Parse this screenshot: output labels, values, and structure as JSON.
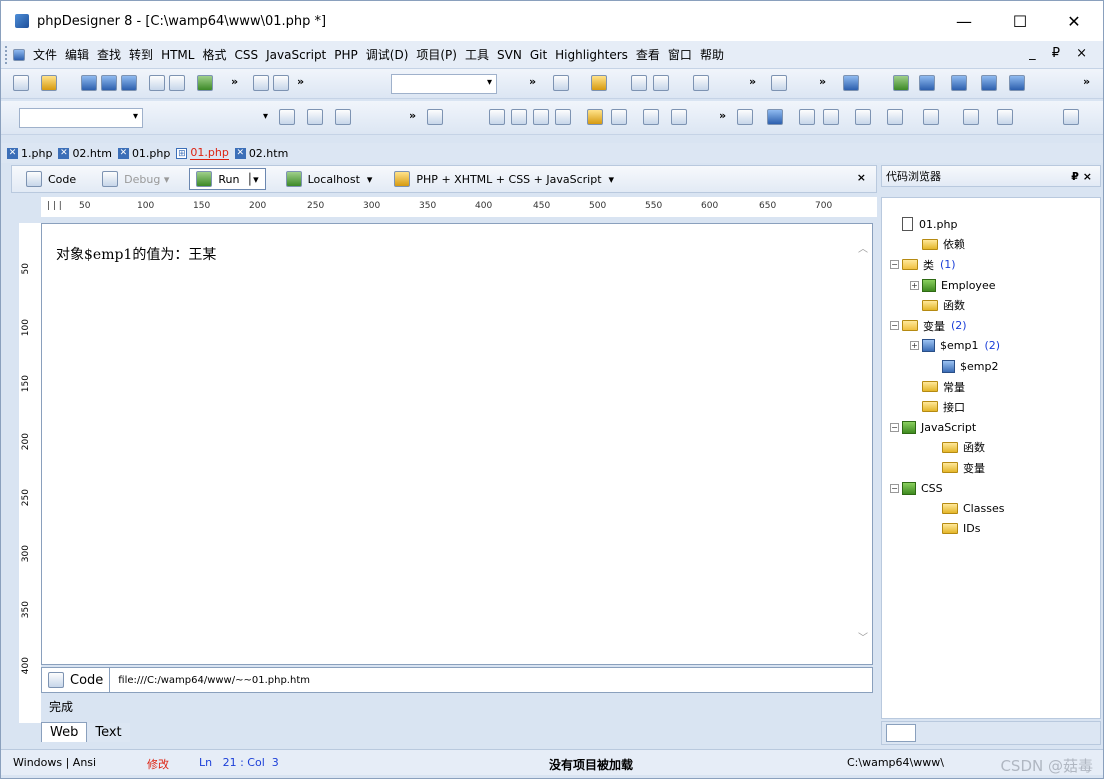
{
  "window": {
    "title": "phpDesigner 8 - [C:\\wamp64\\www\\01.php *]",
    "controls": [
      "—",
      "☐",
      "✕"
    ]
  },
  "menu": {
    "items": [
      "文件",
      "编辑",
      "查找",
      "转到",
      "HTML",
      "格式",
      "CSS",
      "JavaScript",
      "PHP",
      "调试(D)",
      "项目(P)",
      "工具",
      "SVN",
      "Git",
      "Highlighters",
      "查看",
      "窗口",
      "帮助"
    ],
    "right": "_ ₽ ×"
  },
  "tabs": [
    {
      "label": "1.php",
      "active": false
    },
    {
      "label": "02.htm",
      "active": false
    },
    {
      "label": "01.php",
      "active": false
    },
    {
      "label": "01.php",
      "active": true
    },
    {
      "label": "02.htm",
      "active": false
    }
  ],
  "doc_toolbar": {
    "code": "Code",
    "debug": "Debug",
    "run": "Run",
    "localhost": "Localhost",
    "mode": "PHP + XHTML + CSS + JavaScript",
    "close": "×"
  },
  "ruler": [
    "50",
    "100",
    "150",
    "200",
    "250",
    "300",
    "350",
    "400",
    "450",
    "500",
    "550",
    "600",
    "650",
    "700"
  ],
  "vruler": [
    "50",
    "100",
    "150",
    "200",
    "250",
    "300",
    "350",
    "400"
  ],
  "editor": {
    "content": "对象$emp1的值为：王某"
  },
  "address": {
    "code_label": "Code",
    "url": "file:///C:/wamp64/www/~~01.php.htm"
  },
  "status_done": "完成",
  "bottom_tabs": [
    "Web",
    "Text"
  ],
  "panel": {
    "title": "代码浏览器",
    "buttons": "₽ ×",
    "tree": [
      {
        "label": "01.php",
        "type": "file",
        "level": 0
      },
      {
        "label": "依赖",
        "type": "folder",
        "level": 1
      },
      {
        "label": "类",
        "type": "folder-open",
        "level": 0,
        "count": "(1)",
        "exp": "−"
      },
      {
        "label": "Employee",
        "type": "class",
        "level": 1,
        "exp": "+"
      },
      {
        "label": "函数",
        "type": "folder",
        "level": 1
      },
      {
        "label": "变量",
        "type": "folder-open",
        "level": 0,
        "count": "(2)",
        "exp": "−"
      },
      {
        "label": "$emp1",
        "type": "var",
        "level": 1,
        "count": "(2)",
        "exp": "+"
      },
      {
        "label": "$emp2",
        "type": "var",
        "level": 2
      },
      {
        "label": "常量",
        "type": "folder",
        "level": 1
      },
      {
        "label": "接口",
        "type": "folder",
        "level": 1
      },
      {
        "label": "JavaScript",
        "type": "class",
        "level": 0,
        "exp": "−"
      },
      {
        "label": "函数",
        "type": "folder",
        "level": 2
      },
      {
        "label": "变量",
        "type": "folder",
        "level": 2
      },
      {
        "label": "CSS",
        "type": "class",
        "level": 0,
        "exp": "−"
      },
      {
        "label": "Classes",
        "type": "folder",
        "level": 2
      },
      {
        "label": "IDs",
        "type": "folder",
        "level": 2
      }
    ]
  },
  "statusbar": {
    "encoding": "Windows | Ansi",
    "modified": "修改",
    "position": "Ln   21 : Col  3",
    "project": "没有项目被加载",
    "path": "C:\\wamp64\\www\\"
  },
  "watermark": "CSDN @菇毒"
}
